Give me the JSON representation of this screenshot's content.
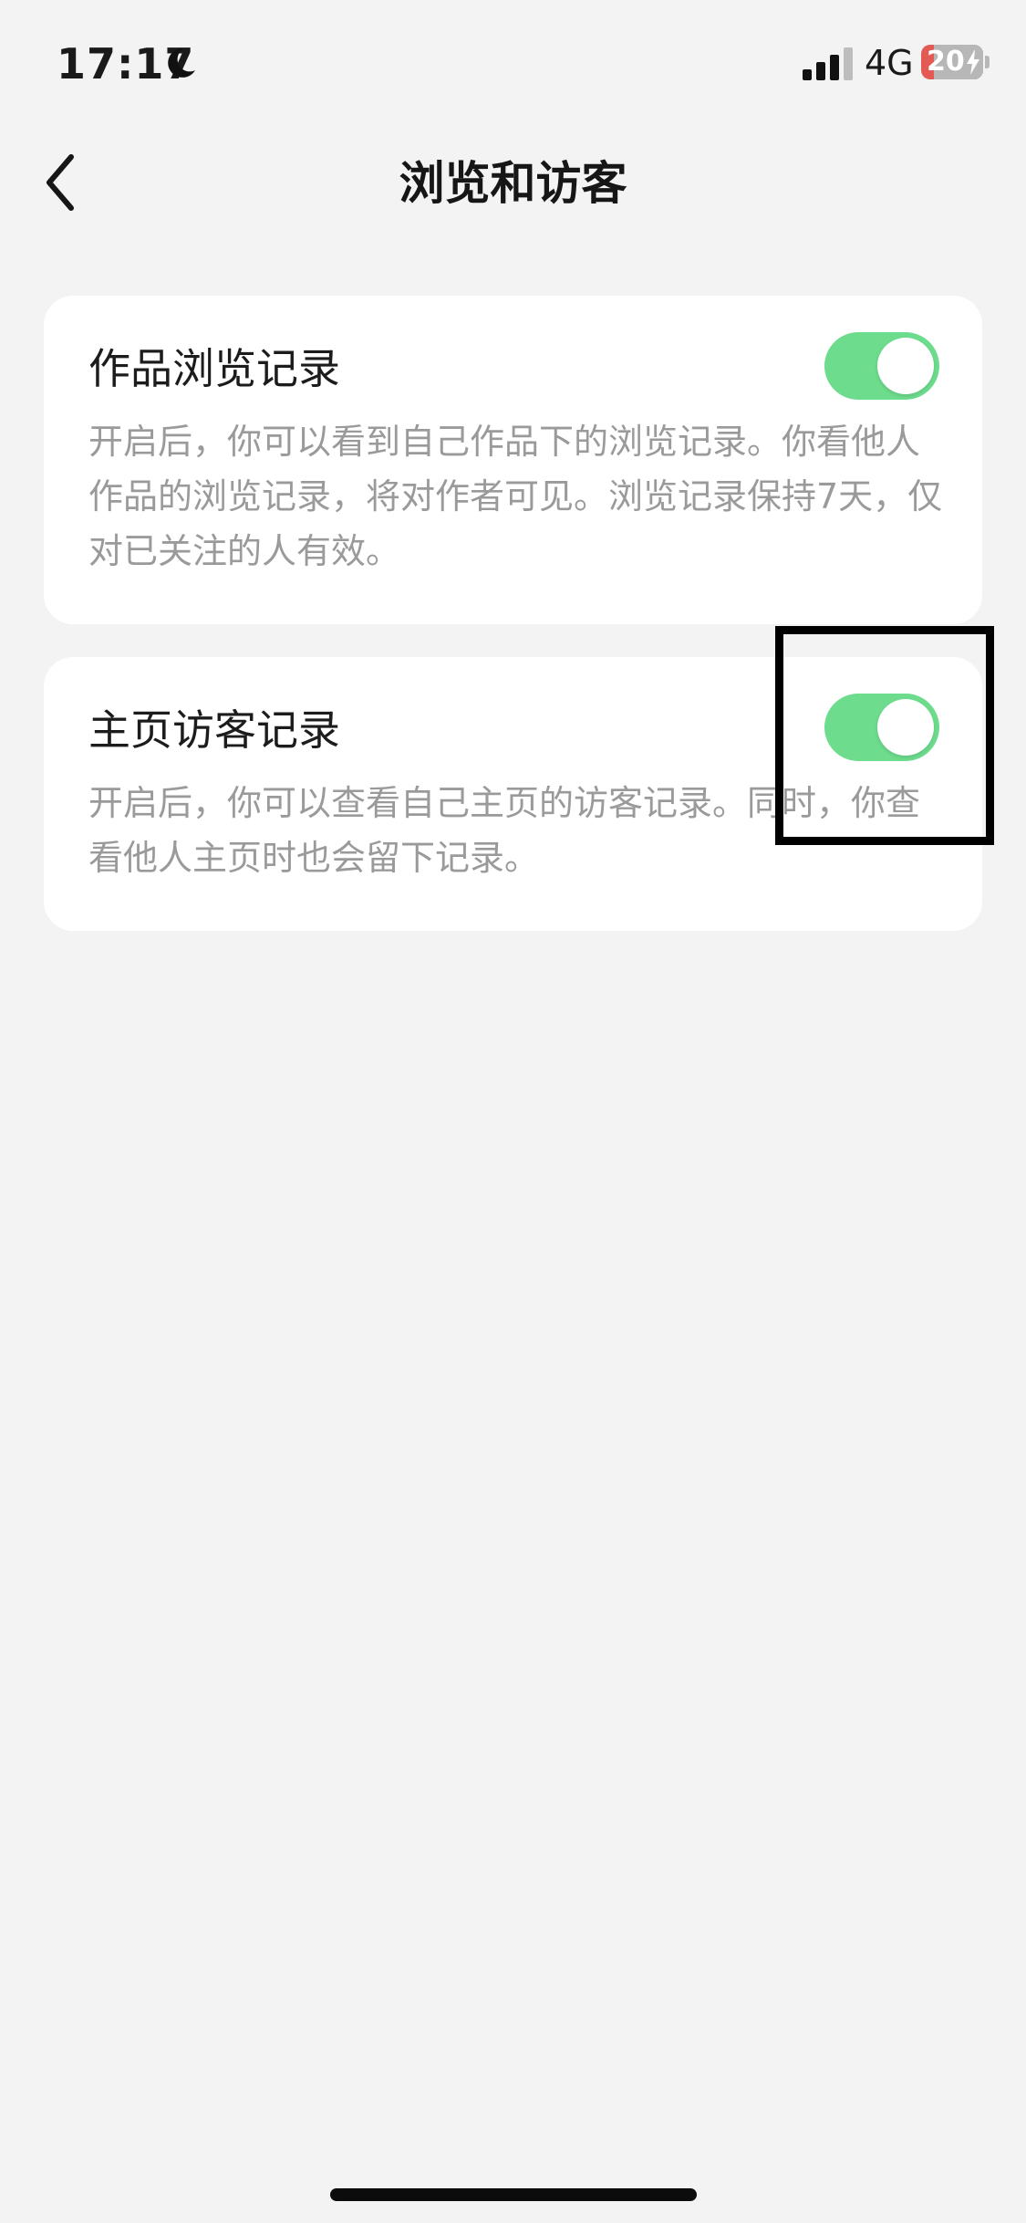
{
  "status_bar": {
    "time": "17:17",
    "network": "4G",
    "battery_text": "20",
    "battery_level_percent": 20,
    "icons": [
      "moon-icon",
      "signal-icon",
      "battery-icon",
      "bolt-icon"
    ]
  },
  "nav": {
    "back_icon": "chevron-left-icon",
    "title": "浏览和访客"
  },
  "settings": [
    {
      "title": "作品浏览记录",
      "description": "开启后，你可以看到自己作品下的浏览记录。你看他人作品的浏览记录，将对作者可见。浏览记录保持7天，仅对已关注的人有效。",
      "enabled": true
    },
    {
      "title": "主页访客记录",
      "description": "开启后，你可以查看自己主页的访客记录。同时，你查看他人主页时也会留下记录。",
      "enabled": true
    }
  ],
  "colors": {
    "background": "#f3f3f3",
    "card": "#ffffff",
    "toggle_on": "#6ddc8d",
    "secondary_text": "#9a9a9a",
    "battery_low": "#e25a53"
  }
}
